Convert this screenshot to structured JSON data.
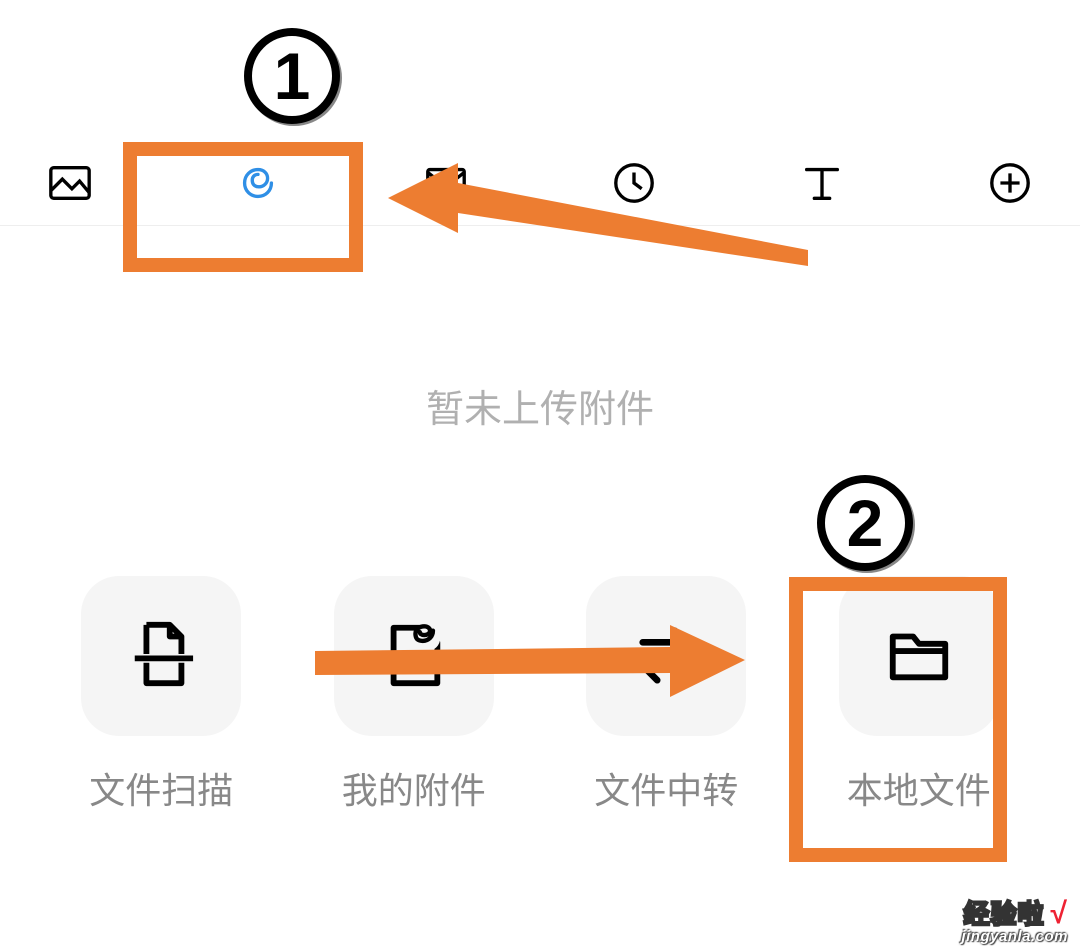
{
  "toolbar": {
    "items": [
      {
        "name": "image-icon"
      },
      {
        "name": "attachment-icon"
      },
      {
        "name": "envelope-icon"
      },
      {
        "name": "clock-icon"
      },
      {
        "name": "text-icon"
      },
      {
        "name": "plus-circle-icon"
      }
    ]
  },
  "placeholder_text": "暂未上传附件",
  "options": [
    {
      "name": "scan-file",
      "label": "文件扫描",
      "icon": "scan"
    },
    {
      "name": "my-attachments",
      "label": "我的附件",
      "icon": "page-clip"
    },
    {
      "name": "file-transfer",
      "label": "文件中转",
      "icon": "transfer"
    },
    {
      "name": "local-file",
      "label": "本地文件",
      "icon": "folder"
    }
  ],
  "annotations": {
    "step1_label": "1",
    "step2_label": "2",
    "highlight_color": "#ed7d31"
  },
  "watermark": {
    "brand": "经验啦",
    "check": "√",
    "url": "jingyanla.com"
  }
}
